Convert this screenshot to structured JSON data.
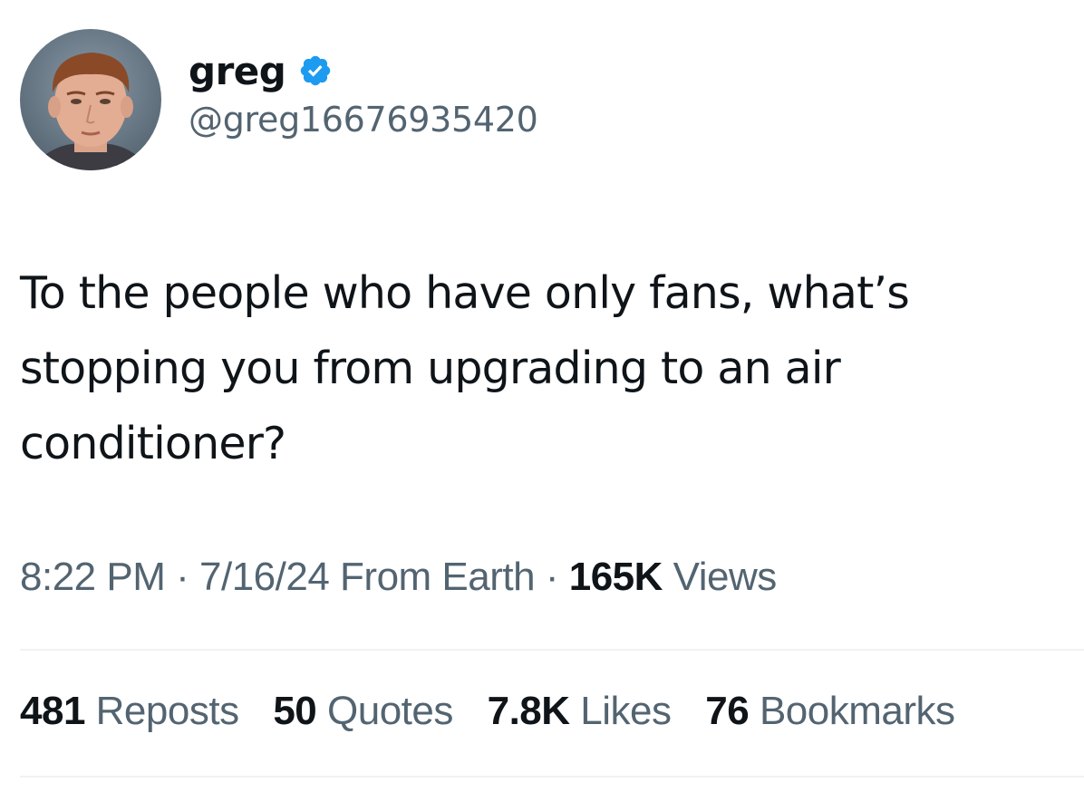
{
  "user": {
    "display_name": "greg",
    "handle": "@greg16676935420",
    "verified": true
  },
  "tweet": {
    "text_lines": [
      "To the people who have only fans, what’s",
      "stopping you from upgrading to an air",
      "conditioner?"
    ]
  },
  "meta": {
    "time": "8:22 PM",
    "date": "7/16/24",
    "source": "From Earth",
    "separator": "·",
    "views_count": "165K",
    "views_label": "Views"
  },
  "stats": [
    {
      "count": "481",
      "label": "Reposts"
    },
    {
      "count": "50",
      "label": "Quotes"
    },
    {
      "count": "7.8K",
      "label": "Likes"
    },
    {
      "count": "76",
      "label": "Bookmarks"
    }
  ],
  "icons": {
    "avatar": "avatar-photo",
    "verified": "verified-badge-icon"
  },
  "colors": {
    "text_primary": "#0f1419",
    "text_secondary": "#536471",
    "verified_blue": "#1d9bf0",
    "divider": "#eff3f4"
  }
}
